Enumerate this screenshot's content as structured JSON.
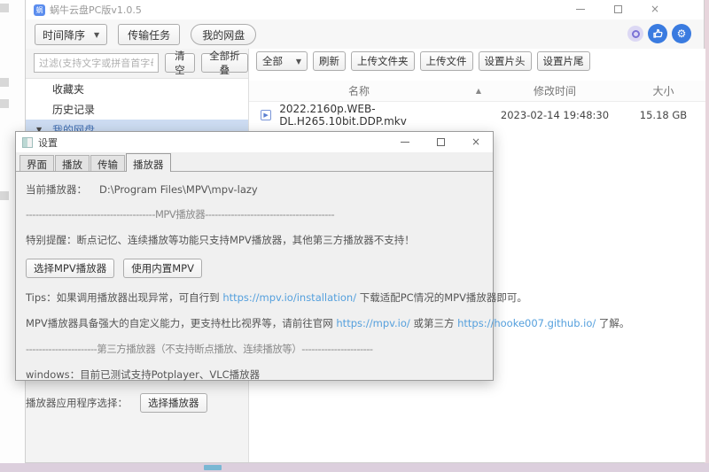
{
  "window": {
    "title": "蜗牛云盘PC版v1.0.5",
    "controls": {
      "close": "×"
    }
  },
  "toolbar": {
    "sort_dropdown": "时间降序",
    "sort_caret": "▼",
    "transfer_button": "传输任务",
    "my_drive_button": "我的网盘",
    "gear_glyph": "⚙"
  },
  "sidebar": {
    "filter_placeholder": "过滤(支持文字或拼音首字母)",
    "clear_button": "清空",
    "collapse_all_button": "全部折叠",
    "items": [
      {
        "label": "收藏夹"
      },
      {
        "label": "历史记录"
      },
      {
        "label": "我的网盘",
        "caret": "▼"
      }
    ]
  },
  "main": {
    "filter_dropdown": "全部",
    "filter_caret": "▼",
    "buttons": [
      "刷新",
      "上传文件夹",
      "上传文件",
      "设置片头",
      "设置片尾"
    ],
    "table": {
      "columns": [
        "名称",
        "修改时间",
        "大小"
      ],
      "sort_indicator": "▲",
      "rows": [
        {
          "icon_glyph": "▶",
          "name": "2022.2160p.WEB-DL.H265.10bit.DDP.mkv",
          "modified": "2023-02-14 19:48:30",
          "size": "15.18 GB"
        }
      ]
    }
  },
  "dialog": {
    "title": "设置",
    "close": "×",
    "tabs": [
      "界面",
      "播放",
      "传输",
      "播放器"
    ],
    "current_player_label": "当前播放器：",
    "current_player_value": "D:\\Program Files\\MPV\\mpv-lazy",
    "separator_mpv": "----------------------------------------MPV播放器----------------------------------------",
    "notice": "特别提醒：断点记忆、连续播放等功能只支持MPV播放器，其他第三方播放器不支持！",
    "select_mpv_button": "选择MPV播放器",
    "builtin_mpv_button": "使用内置MPV",
    "tips_prefix": "Tips：如果调用播放器出现异常，可自行到 ",
    "tips_link": "https://mpv.io/installation/",
    "tips_suffix": " 下载适配PC情况的MPV播放器即可。",
    "mpv_info_prefix": "MPV播放器具备强大的自定义能力，更支持杜比视界等，请前往官网 ",
    "mpv_link": "https://mpv.io/",
    "mpv_info_middle": " 或第三方 ",
    "hooke_link": "https://hooke007.github.io/",
    "mpv_info_suffix": " 了解。",
    "separator_third": "----------------------第三方播放器（不支持断点播放、连续播放等）----------------------",
    "windows_support": "windows：目前已测试支持Potplayer、VLC播放器",
    "player_select_label": "播放器应用程序选择：",
    "select_player_button": "选择播放器"
  }
}
